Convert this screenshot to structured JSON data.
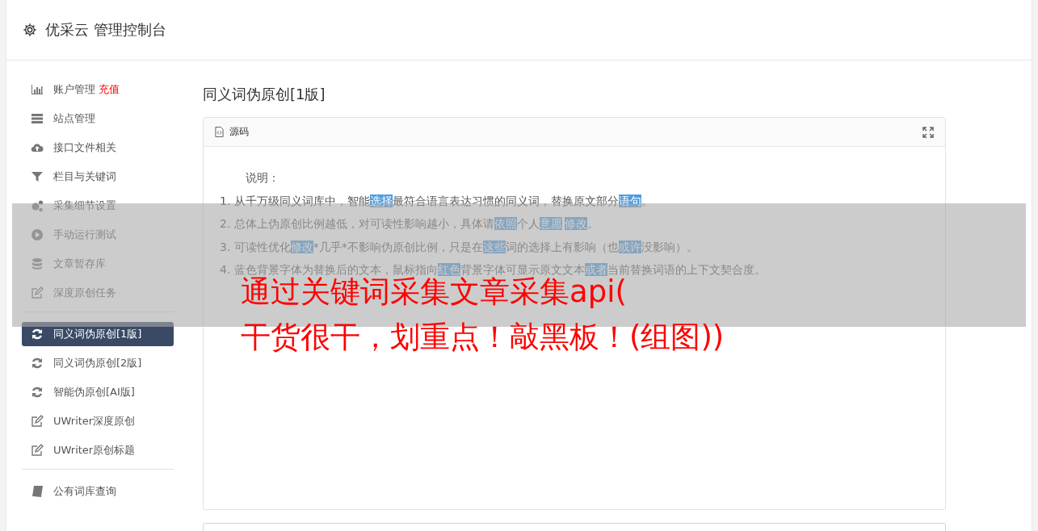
{
  "header": {
    "title": "优采云 管理控制台"
  },
  "sidebar": {
    "groups": [
      {
        "items": [
          {
            "label": "账户管理",
            "badge": "充值",
            "selected": false
          },
          {
            "label": "站点管理",
            "selected": false
          },
          {
            "label": "接口文件相关",
            "selected": false
          },
          {
            "label": "栏目与关键词",
            "selected": false
          },
          {
            "label": "采集细节设置",
            "selected": false
          },
          {
            "label": "手动运行测试",
            "selected": false
          },
          {
            "label": "文章暂存库",
            "selected": false
          },
          {
            "label": "深度原创任务",
            "selected": false
          }
        ]
      },
      {
        "items": [
          {
            "label": "同义词伪原创[1版]",
            "selected": true
          },
          {
            "label": "同义词伪原创[2版]",
            "selected": false
          },
          {
            "label": "智能伪原创[AI版]",
            "selected": false
          },
          {
            "label": "UWriter深度原创",
            "selected": false
          },
          {
            "label": "UWriter原创标题",
            "selected": false
          }
        ]
      },
      {
        "items": [
          {
            "label": "公有词库查询",
            "selected": false
          }
        ]
      }
    ]
  },
  "main": {
    "heading": "同义词伪原创[1版]",
    "panel": {
      "title": "源码",
      "intro": "说明：",
      "lines": [
        [
          {
            "text": "1. 从千万级同义词库中，智能",
            "highlighted": false
          },
          {
            "text": "选择",
            "highlighted": true
          },
          {
            "text": "最符合语言表达习惯的同义词，替换原文部分",
            "highlighted": false
          },
          {
            "text": "语句",
            "highlighted": true
          },
          {
            "text": "。",
            "highlighted": false
          }
        ],
        [
          {
            "text": "2. 总体上伪原创比例越低，对可读性影响越小，具体请",
            "highlighted": false
          },
          {
            "text": "依照",
            "highlighted": true
          },
          {
            "text": "个人",
            "highlighted": false
          },
          {
            "text": "意愿",
            "highlighted": true
          },
          {
            "text": "修改",
            "highlighted": true
          },
          {
            "text": "。",
            "highlighted": false
          }
        ],
        [
          {
            "text": "3. 可读性优化",
            "highlighted": false
          },
          {
            "text": "修改",
            "highlighted": true
          },
          {
            "text": "*几乎*不影响伪原创比例，只是在",
            "highlighted": false
          },
          {
            "text": "这些",
            "highlighted": true
          },
          {
            "text": "词的选择上有影响（也",
            "highlighted": false
          },
          {
            "text": "或许",
            "highlighted": true
          },
          {
            "text": "没影响）。",
            "highlighted": false
          }
        ],
        [
          {
            "text": "4. 蓝色背景字体为替换后的文本，鼠标指向",
            "highlighted": false
          },
          {
            "text": "红色",
            "highlighted": true
          },
          {
            "text": "背景字体可显示原文文本",
            "highlighted": false
          },
          {
            "text": "或者",
            "highlighted": true
          },
          {
            "text": "当前替换词语的上下文契合度。",
            "highlighted": false
          }
        ]
      ]
    }
  },
  "banner": {
    "lines": [
      "通过关键词采集文章采集api(",
      "干货很干，划重点！敲黑板！(组图))"
    ]
  }
}
